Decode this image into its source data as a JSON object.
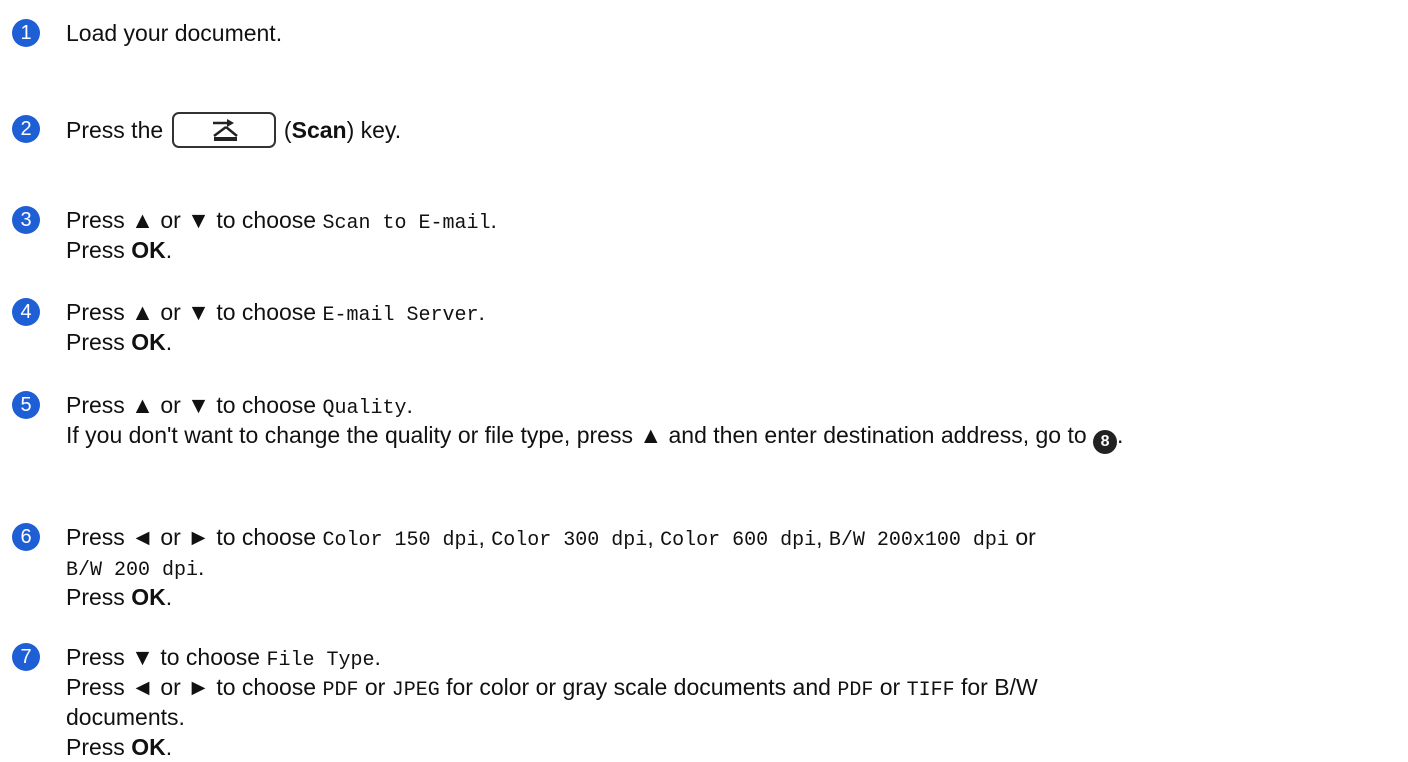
{
  "steps": [
    {
      "num": "1",
      "lines": [
        [
          {
            "t": "Load your document."
          }
        ]
      ]
    },
    {
      "num": "2",
      "lines": [
        [
          {
            "t": "Press the "
          },
          {
            "key": "scan-key"
          },
          {
            "t": " ("
          },
          {
            "b": "Scan"
          },
          {
            "t": ") key."
          }
        ]
      ]
    },
    {
      "num": "3",
      "lines": [
        [
          {
            "t": "Press ▲ or ▼ to choose "
          },
          {
            "m": "Scan to E-mail"
          },
          {
            "t": "."
          }
        ],
        [
          {
            "t": "Press "
          },
          {
            "b": "OK"
          },
          {
            "t": "."
          }
        ]
      ]
    },
    {
      "num": "4",
      "lines": [
        [
          {
            "t": "Press ▲ or ▼ to choose "
          },
          {
            "m": "E-mail Server"
          },
          {
            "t": "."
          }
        ],
        [
          {
            "t": "Press "
          },
          {
            "b": "OK"
          },
          {
            "t": "."
          }
        ]
      ]
    },
    {
      "num": "5",
      "lines": [
        [
          {
            "t": "Press ▲ or ▼ to choose "
          },
          {
            "m": "Quality"
          },
          {
            "t": "."
          }
        ],
        [
          {
            "t": "If you don't want to change the quality or file type, press ▲ and then enter destination address, go to "
          },
          {
            "ref": "8"
          },
          {
            "t": "."
          }
        ]
      ]
    },
    {
      "num": "6",
      "lines": [
        [
          {
            "t": "Press ◄ or ► to choose "
          },
          {
            "m": "Color 150 dpi"
          },
          {
            "t": ", "
          },
          {
            "m": "Color 300 dpi"
          },
          {
            "t": ", "
          },
          {
            "m": "Color 600 dpi"
          },
          {
            "t": ", "
          },
          {
            "m": "B/W 200x100 dpi"
          },
          {
            "t": " or"
          }
        ],
        [
          {
            "m": "B/W 200 dpi"
          },
          {
            "t": "."
          }
        ],
        [
          {
            "t": "Press "
          },
          {
            "b": "OK"
          },
          {
            "t": "."
          }
        ]
      ]
    },
    {
      "num": "7",
      "lines": [
        [
          {
            "t": "Press ▼ to choose "
          },
          {
            "m": "File Type"
          },
          {
            "t": "."
          }
        ],
        [
          {
            "t": "Press ◄ or ► to choose "
          },
          {
            "m": "PDF"
          },
          {
            "t": " or "
          },
          {
            "m": "JPEG"
          },
          {
            "t": " for color or gray scale documents and "
          },
          {
            "m": "PDF"
          },
          {
            "t": " or "
          },
          {
            "m": "TIFF"
          },
          {
            "t": " for B/W"
          }
        ],
        [
          {
            "t": "documents."
          }
        ],
        [
          {
            "t": "Press "
          },
          {
            "b": "OK"
          },
          {
            "t": "."
          }
        ]
      ]
    }
  ],
  "icons": {
    "step_marker": "step-number-circle-icon",
    "scan_key": "scan-key-icon",
    "reference": "step-reference-circle-icon"
  },
  "colors": {
    "step_circle": "#1f5fd6",
    "text": "#111111"
  }
}
